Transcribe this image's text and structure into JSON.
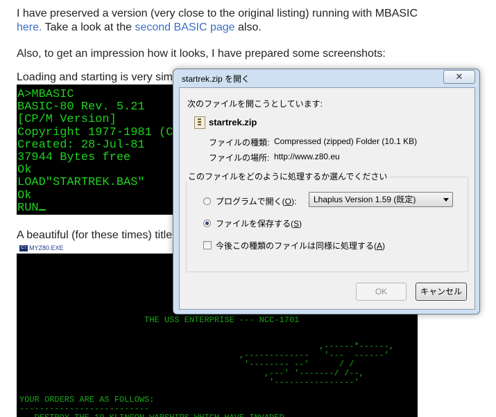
{
  "article": {
    "p1_text": "I have preserved a version (very close to the original listing) running with MBASIC",
    "p1_link": "here.",
    "p1_mid": " Take a look at the ",
    "p1_link2": "second BASIC page",
    "p1_end": " also.",
    "p2": "Also, to get an impression how it looks, I have prepared some screenshots:",
    "p3": "Loading and starting is very sim",
    "p4": "A beautiful (for these times) title"
  },
  "terminal": {
    "lines": "A>MBASIC\nBASIC-80 Rev. 5.21\n[CP/M Version]\nCopyright 1977-1981 (C\nCreated: 28-Jul-81\n37944 Bytes free\nOk\nLOAD\"STARTREK.BAS\"\nOk\nRUN"
  },
  "z80_window": {
    "icon_label": "C:\\",
    "title": "MYZ80.EXE",
    "screen_text": "                         THE USS ENTERPRISE --- NCC-1701\n\n\n                                                            ,------*------,\n                                            ,-------------   '---  ------'\n                                             '-------- --'      / /\n                                                 ,---' '-------/ /--,\n                                                  '----------------'\n\nYOUR ORDERS ARE AS FOLLOWS:\n--------------------------\n   DESTROY THE 19 KLINGON WARSHIPS WHICH HAVE INVADED\n   THE GALAXY BEFORE THEY CAN ATTACK FEDERATION HEADQUARTERS"
  },
  "dialog": {
    "title": "startrek.zip を開く",
    "close_glyph": "✕",
    "intro": "次のファイルを開こうとしています:",
    "filename": "startrek.zip",
    "type_label": "ファイルの種類:",
    "type_value": "Compressed (zipped) Folder (10.1 KB)",
    "location_label": "ファイルの場所:",
    "location_value": "http://www.z80.eu",
    "question": "このファイルをどのように処理するか選んでください",
    "open_with_label": "プログラムで開く(",
    "open_with_key": "O",
    "open_with_end": "):",
    "program_selected": "Lhaplus Version 1.59 (既定)",
    "save_label": "ファイルを保存する(",
    "save_key": "S",
    "save_end": ")",
    "remember_label": "今後この種類のファイルは同様に処理する(",
    "remember_key": "A",
    "remember_end": ")",
    "ok_label": "OK",
    "cancel_label": "キャンセル",
    "selected_option": "save",
    "remember_checked": false
  }
}
